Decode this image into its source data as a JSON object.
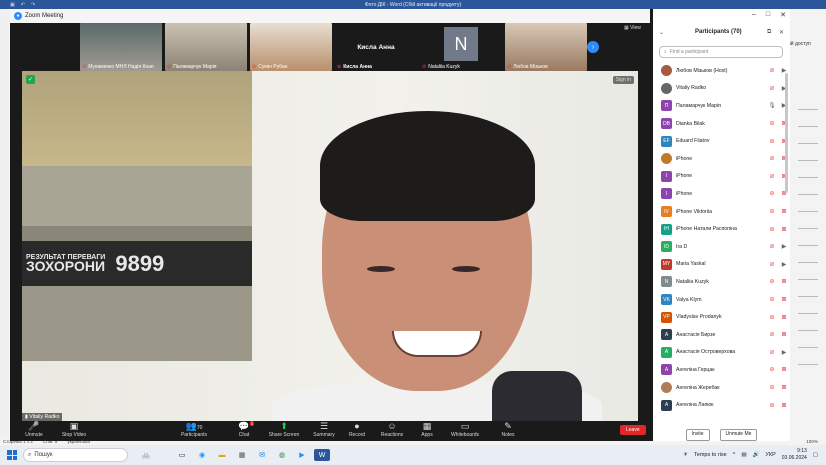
{
  "word": {
    "title": "Фото ДІК - Word (Сбій активації продукту)",
    "access": "ий доступ",
    "status": [
      "Сторінка 1 з 2",
      "Слів: 9",
      "українська"
    ],
    "zoom": "100%"
  },
  "zoom": {
    "window_title": "Zoom Meeting",
    "view_label": "View",
    "sign_in": "Sign in",
    "speaker": "Vitaliy Radko",
    "thumbnails": [
      {
        "name": "Мухаменко МНЛ Надія Кнап"
      },
      {
        "name": "Паламарчук Марія"
      },
      {
        "name": "Сукач Рубан"
      },
      {
        "name": "Кисла Анна",
        "big": "Кисла Анна"
      },
      {
        "name": "Nataliia Kuzyk",
        "initial": "N"
      },
      {
        "name": "Любов Мізьков"
      }
    ],
    "toolbar": [
      {
        "key": "unmute",
        "label": "Unmute",
        "icon": "🎤"
      },
      {
        "key": "video",
        "label": "Stop Video",
        "icon": "▣"
      },
      {
        "key": "participants",
        "label": "Participants",
        "icon": "👥",
        "count": "70"
      },
      {
        "key": "chat",
        "label": "Chat",
        "icon": "💬",
        "badge": "1"
      },
      {
        "key": "share",
        "label": "Share Screen",
        "icon": "⬆"
      },
      {
        "key": "summary",
        "label": "Summary",
        "icon": "☰"
      },
      {
        "key": "record",
        "label": "Record",
        "icon": "●"
      },
      {
        "key": "reactions",
        "label": "Reactions",
        "icon": "☺"
      },
      {
        "key": "apps",
        "label": "Apps",
        "icon": "▦"
      },
      {
        "key": "whiteboards",
        "label": "Whiteboards",
        "icon": "▭"
      },
      {
        "key": "notes",
        "label": "Notes",
        "icon": "✎"
      }
    ],
    "leave": "Leave",
    "video_text": {
      "banner1": "ЗОХОРОНИ",
      "banner0": "РЕЗУЛЬТАТ ПЕРЕВАГИ",
      "number": "9899"
    }
  },
  "participants": {
    "title": "Participants (70)",
    "search_placeholder": "Find a participant",
    "invite": "Invite",
    "unmute_me": "Unmute Me",
    "items": [
      {
        "name": "Любов Мізьков (Host)",
        "initials": "",
        "color": "#a45c3c",
        "photo": true,
        "mic": "muted",
        "cam": "on"
      },
      {
        "name": "Vitaliy Radko",
        "initials": "",
        "color": "#666",
        "photo": true,
        "mic": "muted",
        "cam": "on"
      },
      {
        "name": "Паламарчук Марія",
        "initials": "П",
        "color": "#8e44ad",
        "photo": false,
        "mic": "on",
        "cam": "on"
      },
      {
        "name": "Dianka Bilak",
        "initials": "DB",
        "color": "#8e44ad",
        "photo": false,
        "mic": "muted",
        "cam": "off"
      },
      {
        "name": "Eduard Filatov",
        "initials": "EF",
        "color": "#2e86c1",
        "photo": false,
        "mic": "muted",
        "cam": "off"
      },
      {
        "name": "iPhone",
        "initials": "",
        "color": "#c0792c",
        "photo": true,
        "mic": "muted",
        "cam": "off"
      },
      {
        "name": "iPhone",
        "initials": "I",
        "color": "#8e44ad",
        "photo": false,
        "mic": "muted",
        "cam": "off"
      },
      {
        "name": "iPhone",
        "initials": "I",
        "color": "#8e44ad",
        "photo": false,
        "mic": "muted",
        "cam": "off"
      },
      {
        "name": "iPhone Viktoriia",
        "initials": "IV",
        "color": "#e67e22",
        "photo": false,
        "mic": "muted",
        "cam": "off"
      },
      {
        "name": "iPhone Натали Распопіна",
        "initials": "IH",
        "color": "#16a085",
        "photo": false,
        "mic": "muted",
        "cam": "off"
      },
      {
        "name": "Ira D",
        "initials": "ID",
        "color": "#27ae60",
        "photo": false,
        "mic": "muted",
        "cam": "on"
      },
      {
        "name": "Maria Yaskal",
        "initials": "MY",
        "color": "#c0392b",
        "photo": false,
        "mic": "muted",
        "cam": "on"
      },
      {
        "name": "Nataliia Kuzyk",
        "initials": "N",
        "color": "#7f8c8d",
        "photo": false,
        "mic": "muted",
        "cam": "off"
      },
      {
        "name": "Valya Klym",
        "initials": "VK",
        "color": "#2e86c1",
        "photo": false,
        "mic": "muted",
        "cam": "off"
      },
      {
        "name": "Vladyslav Prodanyk",
        "initials": "VP",
        "color": "#d35400",
        "photo": false,
        "mic": "muted",
        "cam": "off"
      },
      {
        "name": "Анастасія Бирзе",
        "initials": "A",
        "color": "#2c3e50",
        "photo": false,
        "mic": "muted",
        "cam": "off"
      },
      {
        "name": "Анастасія Островерхова",
        "initials": "A",
        "color": "#27ae60",
        "photo": false,
        "mic": "muted",
        "cam": "on"
      },
      {
        "name": "Ангеліна Герцак",
        "initials": "A",
        "color": "#8e44ad",
        "photo": false,
        "mic": "muted",
        "cam": "off"
      },
      {
        "name": "Ангеліна Жеребак",
        "initials": "",
        "color": "#b07d5a",
        "photo": true,
        "mic": "muted",
        "cam": "off"
      },
      {
        "name": "Ангеліна Лапюк",
        "initials": "A",
        "color": "#2c3e50",
        "photo": false,
        "mic": "muted",
        "cam": "off"
      }
    ]
  },
  "taskbar": {
    "search": "Пошук",
    "weather": "Temps to rise",
    "lang": "УКР",
    "time": "9:13",
    "date": "03.06.2024"
  },
  "colors": {
    "zoom_blue": "#2d8cff",
    "leave_red": "#e02828",
    "muted_red": "#e03e3e",
    "share_green": "#23d160"
  }
}
